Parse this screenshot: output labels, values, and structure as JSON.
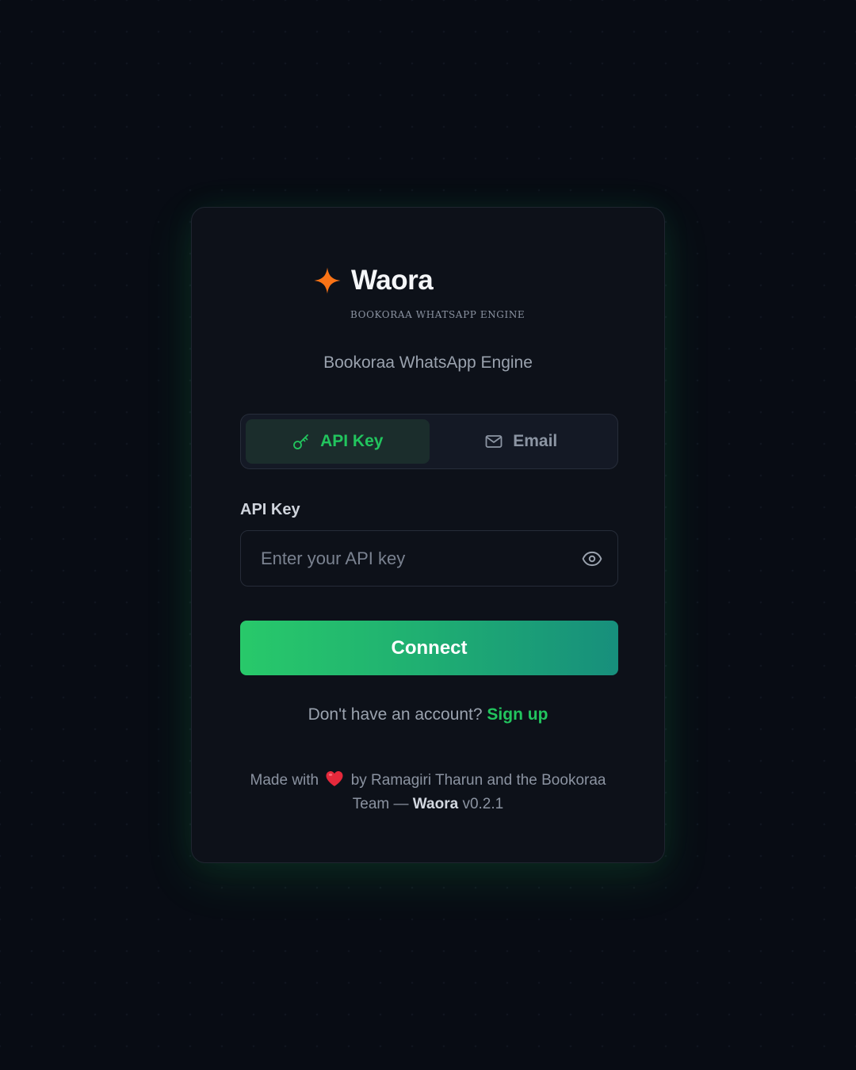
{
  "brand": {
    "name": "Waora",
    "tagline": "BOOKORAA WHATSAPP ENGINE",
    "star_color": "#f97316"
  },
  "subtitle": "Bookoraa WhatsApp Engine",
  "tabs": [
    {
      "label": "API Key",
      "icon": "key-icon",
      "active": true
    },
    {
      "label": "Email",
      "icon": "mail-icon",
      "active": false
    }
  ],
  "form": {
    "label": "API Key",
    "placeholder": "Enter your API key",
    "value": "",
    "submit_label": "Connect"
  },
  "signup": {
    "prompt": "Don't have an account?",
    "link": "Sign up"
  },
  "footer": {
    "prefix": "Made with",
    "icon": "heart-icon",
    "middle": "by Ramagiri Tharun and the Bookoraa Team —",
    "brand": "Waora",
    "version": "v0.2.1"
  },
  "colors": {
    "background": "#080c14",
    "card": "#0d1119",
    "accent": "#22c55e",
    "button_gradient_start": "#28c96a",
    "button_gradient_end": "#178f7c"
  }
}
